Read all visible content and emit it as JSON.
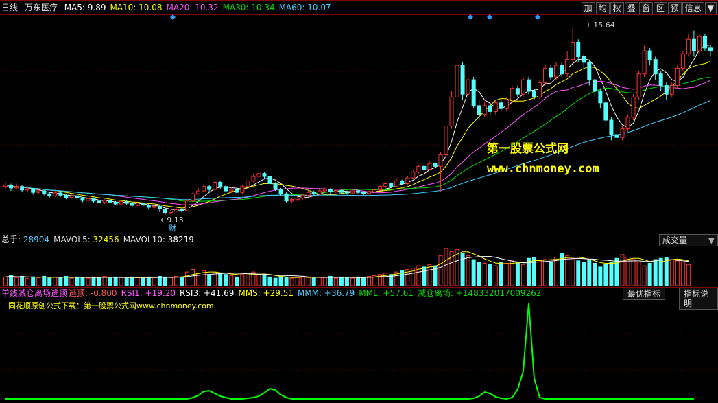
{
  "header": {
    "period": "日线",
    "stock_name": "万东医疗",
    "ma": [
      {
        "label": "MA5:",
        "value": "9.89",
        "color": "#ffffff"
      },
      {
        "label": "MA10:",
        "value": "10.08",
        "color": "#ffff00"
      },
      {
        "label": "MA20:",
        "value": "10.32",
        "color": "#ff55ff"
      },
      {
        "label": "MA30:",
        "value": "10.34",
        "color": "#00e000"
      },
      {
        "label": "MA60:",
        "value": "10.07",
        "color": "#44ccff"
      }
    ]
  },
  "toolbar": {
    "buttons": [
      "加",
      "均",
      "权",
      "叠",
      "窗",
      "区",
      "预",
      "信息"
    ],
    "menu_icon": "triangle-down-icon"
  },
  "price_labels": {
    "high": "15.64",
    "low": "9.13",
    "low_marker": "财"
  },
  "watermark": {
    "line1": "第一股票公式网",
    "line2": "www.chnmoney.com"
  },
  "volume_header": {
    "items": [
      {
        "label": "总手:",
        "value": "28904",
        "color": "#44ccff"
      },
      {
        "label": "MAVOL5:",
        "value": "32456",
        "color": "#ffff00"
      },
      {
        "label": "MAVOL10:",
        "value": "38219",
        "color": "#ffffff"
      }
    ],
    "selector": "成交量"
  },
  "indicator_header": {
    "name": "单线减仓离场逃顶",
    "items": [
      {
        "label": "逃顶:",
        "value": "-0.800",
        "color": "#ff5555"
      },
      {
        "label": "RSI1:",
        "value": "+19.20",
        "color": "#ff55ff"
      },
      {
        "label": "RSI3:",
        "value": "+41.69",
        "color": "#ffffff"
      },
      {
        "label": "MMS:",
        "value": "+29.51",
        "color": "#ffff00"
      },
      {
        "label": "MMM:",
        "value": "+36.79",
        "color": "#44ccff"
      },
      {
        "label": "MML:",
        "value": "+57.61",
        "color": "#00e000"
      },
      {
        "label": "减仓离场:",
        "value": "+148332017009262",
        "color": "#00e000"
      }
    ],
    "btn_best": "最优指标",
    "btn_help": "指标说明",
    "note": "同花顺原创公式下载：第一股票公式网www.chnmoney.com"
  },
  "chart_data": {
    "type": "candlestick",
    "candles": [
      [
        10.1,
        10.15,
        10.25,
        10.0
      ],
      [
        10.15,
        10.05,
        10.2,
        9.95
      ],
      [
        10.05,
        10.1,
        10.2,
        10.0
      ],
      [
        10.1,
        9.98,
        10.15,
        9.9
      ],
      [
        9.98,
        10.02,
        10.1,
        9.92
      ],
      [
        10.02,
        9.9,
        10.05,
        9.82
      ],
      [
        9.9,
        9.95,
        10.0,
        9.85
      ],
      [
        9.95,
        9.85,
        10.0,
        9.8
      ],
      [
        9.85,
        9.78,
        9.9,
        9.72
      ],
      [
        9.78,
        9.88,
        9.95,
        9.74
      ],
      [
        9.88,
        9.8,
        9.92,
        9.75
      ],
      [
        9.8,
        9.72,
        9.84,
        9.66
      ],
      [
        9.72,
        9.78,
        9.82,
        9.68
      ],
      [
        9.78,
        9.7,
        9.8,
        9.64
      ],
      [
        9.7,
        9.62,
        9.74,
        9.56
      ],
      [
        9.62,
        9.68,
        9.72,
        9.58
      ],
      [
        9.68,
        9.6,
        9.72,
        9.55
      ],
      [
        9.6,
        9.55,
        9.65,
        9.5
      ],
      [
        9.55,
        9.62,
        9.66,
        9.5
      ],
      [
        9.62,
        9.56,
        9.66,
        9.52
      ],
      [
        9.56,
        9.5,
        9.6,
        9.45
      ],
      [
        9.5,
        9.58,
        9.62,
        9.46
      ],
      [
        9.58,
        9.52,
        9.62,
        9.48
      ],
      [
        9.52,
        9.45,
        9.56,
        9.4
      ],
      [
        9.45,
        9.52,
        9.56,
        9.42
      ],
      [
        9.52,
        9.46,
        9.56,
        9.42
      ],
      [
        9.46,
        9.38,
        9.5,
        9.3
      ],
      [
        9.38,
        9.42,
        9.46,
        9.3
      ],
      [
        9.42,
        9.32,
        9.45,
        9.22
      ],
      [
        9.32,
        9.2,
        9.36,
        9.13
      ],
      [
        9.2,
        9.25,
        9.3,
        9.15
      ],
      [
        9.25,
        9.3,
        9.36,
        9.2
      ],
      [
        9.3,
        9.26,
        9.34,
        9.2
      ],
      [
        9.26,
        9.6,
        9.66,
        9.24
      ],
      [
        9.6,
        9.85,
        9.92,
        9.55
      ],
      [
        9.85,
        9.95,
        10.05,
        9.8
      ],
      [
        9.95,
        10.1,
        10.2,
        9.9
      ],
      [
        10.1,
        10.0,
        10.15,
        9.9
      ],
      [
        10.0,
        10.25,
        10.32,
        9.95
      ],
      [
        10.25,
        10.1,
        10.3,
        10.0
      ],
      [
        10.1,
        9.95,
        10.15,
        9.9
      ],
      [
        9.95,
        10.0,
        10.08,
        9.88
      ],
      [
        10.0,
        9.9,
        10.05,
        9.82
      ],
      [
        9.9,
        10.1,
        10.15,
        9.85
      ],
      [
        10.1,
        10.3,
        10.36,
        10.05
      ],
      [
        10.3,
        10.45,
        10.52,
        10.25
      ],
      [
        10.45,
        10.55,
        10.6,
        10.4
      ],
      [
        10.55,
        10.45,
        10.6,
        10.35
      ],
      [
        10.45,
        10.2,
        10.48,
        10.1
      ],
      [
        10.2,
        10.0,
        10.25,
        9.95
      ],
      [
        10.0,
        9.85,
        10.05,
        9.78
      ],
      [
        9.85,
        9.6,
        9.9,
        9.55
      ],
      [
        9.6,
        9.65,
        9.72,
        9.55
      ],
      [
        9.65,
        9.7,
        9.76,
        9.6
      ],
      [
        9.7,
        9.8,
        9.86,
        9.65
      ],
      [
        9.8,
        9.9,
        9.95,
        9.75
      ],
      [
        9.9,
        9.85,
        9.96,
        9.8
      ],
      [
        9.85,
        9.95,
        10.0,
        9.8
      ],
      [
        9.95,
        10.0,
        10.06,
        9.9
      ],
      [
        10.0,
        9.92,
        10.04,
        9.86
      ],
      [
        9.92,
        9.96,
        10.02,
        9.88
      ],
      [
        9.96,
        9.9,
        10.0,
        9.84
      ],
      [
        9.9,
        9.88,
        9.96,
        9.82
      ],
      [
        9.88,
        9.95,
        9.98,
        9.84
      ],
      [
        9.95,
        9.9,
        9.98,
        9.85
      ],
      [
        9.9,
        9.86,
        9.94,
        9.8
      ],
      [
        9.86,
        9.92,
        9.96,
        9.82
      ],
      [
        9.92,
        9.98,
        10.02,
        9.88
      ],
      [
        9.98,
        10.1,
        10.15,
        9.95
      ],
      [
        10.1,
        10.2,
        10.26,
        10.05
      ],
      [
        10.2,
        10.1,
        10.24,
        10.05
      ],
      [
        10.1,
        10.3,
        10.36,
        10.08
      ],
      [
        10.3,
        10.2,
        10.34,
        10.15
      ],
      [
        10.2,
        10.4,
        10.46,
        10.15
      ],
      [
        10.4,
        10.6,
        10.66,
        10.35
      ],
      [
        10.6,
        10.8,
        10.86,
        10.55
      ],
      [
        10.8,
        10.7,
        10.86,
        10.62
      ],
      [
        10.7,
        10.9,
        10.96,
        10.65
      ],
      [
        10.9,
        10.8,
        10.98,
        10.7
      ],
      [
        10.8,
        11.2,
        11.3,
        9.9
      ],
      [
        11.2,
        12.2,
        12.3,
        11.1
      ],
      [
        12.2,
        13.2,
        13.4,
        12.1
      ],
      [
        13.2,
        14.3,
        14.5,
        13.1
      ],
      [
        14.3,
        13.3,
        14.4,
        13.1
      ],
      [
        13.3,
        13.8,
        14.0,
        13.2
      ],
      [
        13.8,
        12.9,
        13.9,
        12.8
      ],
      [
        12.9,
        12.6,
        13.1,
        12.4
      ],
      [
        12.6,
        12.9,
        13.05,
        12.5
      ],
      [
        12.9,
        12.7,
        13.0,
        12.55
      ],
      [
        12.7,
        13.0,
        13.1,
        12.6
      ],
      [
        13.0,
        12.8,
        13.1,
        12.7
      ],
      [
        12.8,
        13.1,
        13.2,
        12.7
      ],
      [
        13.1,
        13.5,
        13.6,
        13.0
      ],
      [
        13.5,
        13.3,
        13.6,
        13.2
      ],
      [
        13.3,
        13.8,
        13.9,
        13.2
      ],
      [
        13.8,
        13.4,
        13.9,
        13.3
      ],
      [
        13.4,
        13.2,
        13.5,
        13.1
      ],
      [
        13.2,
        13.7,
        13.8,
        13.1
      ],
      [
        13.7,
        14.2,
        14.3,
        13.6
      ],
      [
        14.2,
        13.9,
        14.3,
        13.8
      ],
      [
        13.9,
        14.3,
        14.4,
        13.8
      ],
      [
        14.3,
        14.0,
        14.4,
        13.9
      ],
      [
        14.0,
        14.5,
        14.8,
        13.9
      ],
      [
        14.5,
        15.1,
        15.64,
        14.4
      ],
      [
        15.1,
        14.6,
        15.2,
        14.4
      ],
      [
        14.6,
        14.4,
        14.7,
        14.2
      ],
      [
        14.4,
        13.8,
        14.5,
        13.6
      ],
      [
        13.8,
        13.4,
        13.9,
        13.2
      ],
      [
        13.4,
        13.0,
        13.5,
        12.8
      ],
      [
        13.0,
        12.4,
        13.1,
        12.2
      ],
      [
        12.4,
        11.9,
        12.5,
        11.7
      ],
      [
        11.9,
        11.8,
        12.0,
        11.6
      ],
      [
        11.8,
        12.1,
        12.2,
        11.7
      ],
      [
        12.1,
        12.5,
        12.6,
        12.0
      ],
      [
        12.5,
        13.2,
        13.3,
        12.4
      ],
      [
        13.2,
        14.0,
        14.1,
        13.1
      ],
      [
        14.0,
        14.8,
        15.0,
        13.9
      ],
      [
        14.8,
        14.5,
        14.9,
        14.3
      ],
      [
        14.5,
        14.0,
        14.6,
        13.8
      ],
      [
        14.0,
        13.6,
        14.1,
        13.4
      ],
      [
        13.6,
        13.3,
        13.7,
        13.1
      ],
      [
        13.3,
        13.6,
        13.7,
        13.2
      ],
      [
        13.6,
        14.2,
        14.3,
        13.5
      ],
      [
        14.2,
        14.7,
        14.8,
        14.1
      ],
      [
        14.7,
        15.2,
        15.4,
        14.6
      ],
      [
        15.2,
        14.8,
        15.5,
        14.6
      ],
      [
        14.8,
        15.3,
        15.4,
        14.7
      ],
      [
        15.3,
        14.9,
        15.4,
        14.8
      ],
      [
        14.9,
        14.8,
        15.0,
        14.6
      ]
    ],
    "volumes": [
      14,
      16,
      13,
      15,
      12,
      14,
      13,
      15,
      12,
      14,
      13,
      15,
      12,
      14,
      13,
      12,
      14,
      13,
      15,
      12,
      14,
      13,
      12,
      14,
      13,
      12,
      14,
      13,
      15,
      14,
      13,
      15,
      14,
      22,
      26,
      20,
      24,
      18,
      22,
      20,
      18,
      16,
      14,
      18,
      20,
      22,
      18,
      16,
      14,
      12,
      15,
      13,
      12,
      14,
      15,
      13,
      12,
      14,
      13,
      15,
      12,
      14,
      13,
      12,
      14,
      13,
      15,
      16,
      18,
      20,
      18,
      22,
      24,
      26,
      28,
      32,
      30,
      34,
      32,
      48,
      60,
      55,
      58,
      52,
      48,
      42,
      38,
      36,
      34,
      32,
      38,
      36,
      40,
      38,
      34,
      44,
      46,
      40,
      42,
      38,
      46,
      52,
      48,
      44,
      40,
      38,
      42,
      36,
      30,
      34,
      38,
      44,
      50,
      46,
      42,
      38,
      32,
      36,
      42,
      44,
      46,
      42,
      40,
      38,
      34
    ],
    "indicator": [
      0,
      0,
      0,
      0,
      0,
      0,
      0,
      0,
      0,
      0,
      0,
      0,
      0,
      0,
      0,
      0,
      0,
      0,
      0,
      0,
      0,
      0,
      0,
      0,
      0,
      0,
      0,
      0,
      0,
      0,
      0,
      0,
      0,
      0,
      2,
      5,
      11,
      12,
      8,
      4,
      2,
      0,
      0,
      0,
      1,
      2,
      4,
      9,
      15,
      13,
      6,
      2,
      0,
      0,
      0,
      0,
      0,
      0,
      0,
      0,
      0,
      0,
      0,
      0,
      0,
      0,
      0,
      0,
      0,
      0,
      0,
      0,
      0,
      0,
      0,
      0,
      0,
      0,
      0,
      0,
      0,
      0,
      0,
      0,
      0,
      1,
      4,
      10,
      8,
      3,
      1,
      0,
      2,
      14,
      40,
      140,
      30,
      2,
      0,
      0,
      0,
      0,
      0,
      0,
      0,
      0,
      0,
      0,
      0,
      0,
      0,
      0,
      0,
      0,
      0,
      0,
      0,
      0,
      0,
      0,
      0,
      0,
      0,
      0,
      0,
      0
    ]
  }
}
